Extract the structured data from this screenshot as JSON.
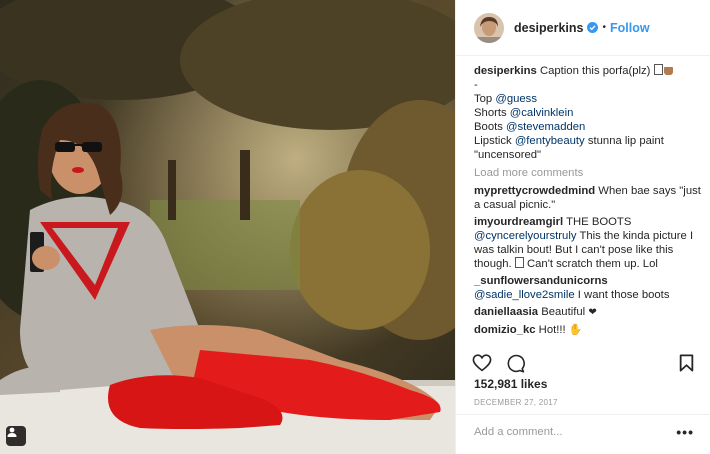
{
  "post": {
    "username": "desiperkins",
    "follow_label": "Follow",
    "dot": "•",
    "icons": {
      "verified": "verified-badge-icon",
      "like": "heart-icon",
      "comment": "comment-icon",
      "save": "bookmark-icon",
      "tag": "person-tag-icon",
      "more": "more-options-icon"
    },
    "colors": {
      "accent": "#3897f0",
      "mention": "#003569",
      "muted": "#999999",
      "boots": "#e31b1b"
    }
  },
  "caption": {
    "username": "desiperkins",
    "text": "Caption this porfa(plz)",
    "dash": "-",
    "lines": [
      {
        "label": "Top",
        "mention": "@guess",
        "tail": ""
      },
      {
        "label": "Shorts",
        "mention": "@calvinklein",
        "tail": ""
      },
      {
        "label": "Boots",
        "mention": "@stevemadden",
        "tail": ""
      },
      {
        "label": "Lipstick",
        "mention": "@fentybeauty",
        "tail": "stunna lip paint"
      }
    ],
    "last_line": "\"uncensored\""
  },
  "load_more": "Load more comments",
  "comments": [
    {
      "user": "myprettycrowdedmind",
      "text": "When bae says \"just a casual picnic.\""
    },
    {
      "user": "imyourdreamgirl",
      "text": "THE BOOTS",
      "mention": "@cyncerelyourstruly",
      "text2": "This the kinda picture I was talkin bout! But I can't pose like this though.",
      "text3": "Can't scratch them up. Lol"
    },
    {
      "user": "_sunflowersandunicorns",
      "mention": "@sadie_llove2smile",
      "text": "I want those boots"
    },
    {
      "user": "daniellaasia",
      "text": "Beautiful"
    },
    {
      "user": "domizio_kc",
      "text": "Hot!!!"
    }
  ],
  "likes": "152,981 likes",
  "date": "DECEMBER 27, 2017",
  "add_comment_placeholder": "Add a comment...",
  "more_glyph": "•••"
}
